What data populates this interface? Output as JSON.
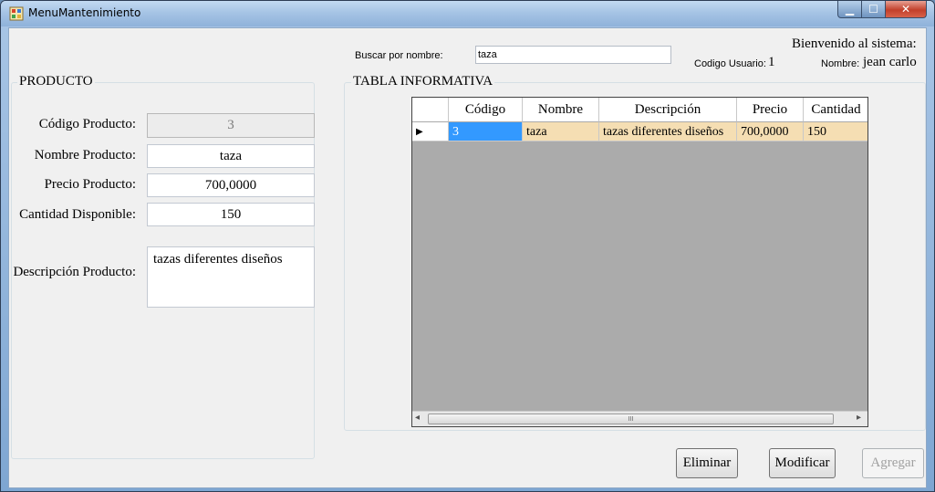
{
  "window": {
    "title": "MenuMantenimiento",
    "min_glyph": "▁",
    "max_glyph": "☐",
    "close_glyph": "✕",
    "icon": "app-window-icon"
  },
  "header": {
    "search_label": "Buscar por nombre:",
    "search_value": "taza",
    "welcome": "Bienvenido al sistema:",
    "user_code_label": "Codigo Usuario:",
    "user_code_value": "1",
    "user_name_label": "Nombre:",
    "user_name_value": "jean carlo"
  },
  "producto": {
    "legend": "PRODUCTO",
    "codigo_label": "Código Producto:",
    "codigo_value": "3",
    "nombre_label": "Nombre Producto:",
    "nombre_value": "taza",
    "precio_label": "Precio Producto:",
    "precio_value": "700,0000",
    "cantidad_label": "Cantidad Disponible:",
    "cantidad_value": "150",
    "descripcion_label": "Descripción Producto:",
    "descripcion_value": "tazas diferentes diseños"
  },
  "tabla": {
    "legend": "TABLA INFORMATIVA",
    "columns": [
      "Código",
      "Nombre",
      "Descripción",
      "Precio",
      "Cantidad"
    ],
    "rows": [
      [
        "3",
        "taza",
        "tazas diferentes diseños",
        "700,0000",
        "150"
      ]
    ],
    "row_indicator": "▶",
    "scroll_left": "◂",
    "scroll_right": "▸",
    "scroll_grip": "III"
  },
  "buttons": {
    "eliminar": "Eliminar",
    "modificar": "Modificar",
    "agregar": "Agregar"
  },
  "colors": {
    "selected_row": "#f5deb3",
    "selected_cell": "#3399ff",
    "grid_background": "#ababab"
  }
}
